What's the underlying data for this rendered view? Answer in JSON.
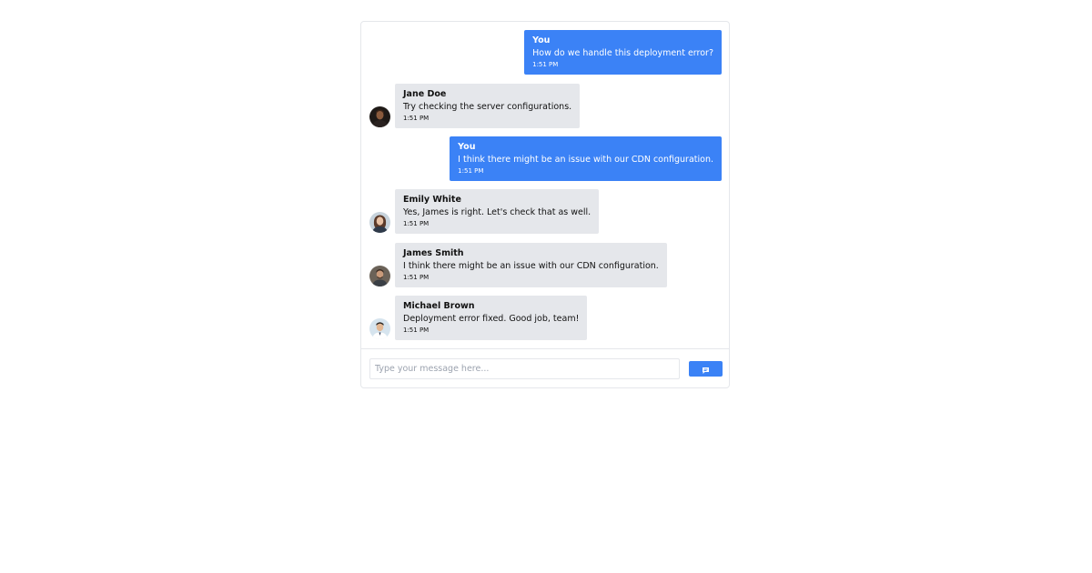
{
  "composer": {
    "placeholder": "Type your message here...",
    "send_icon": "chat-bubble-icon"
  },
  "messages": [
    {
      "sender": "You",
      "text": "How do we handle this deployment error?",
      "time": "1:51 PM",
      "own": true
    },
    {
      "sender": "Jane Doe",
      "text": "Try checking the server configurations.",
      "time": "1:51 PM",
      "own": false
    },
    {
      "sender": "You",
      "text": "I think there might be an issue with our CDN configuration.",
      "time": "1:51 PM",
      "own": true
    },
    {
      "sender": "Emily White",
      "text": "Yes, James is right. Let's check that as well.",
      "time": "1:51 PM",
      "own": false
    },
    {
      "sender": "James Smith",
      "text": "I think there might be an issue with our CDN configuration.",
      "time": "1:51 PM",
      "own": false
    },
    {
      "sender": "Michael Brown",
      "text": "Deployment error fixed. Good job, team!",
      "time": "1:51 PM",
      "own": false
    }
  ],
  "colors": {
    "accent": "#3b82f6",
    "incoming_bubble": "#e5e7eb"
  }
}
